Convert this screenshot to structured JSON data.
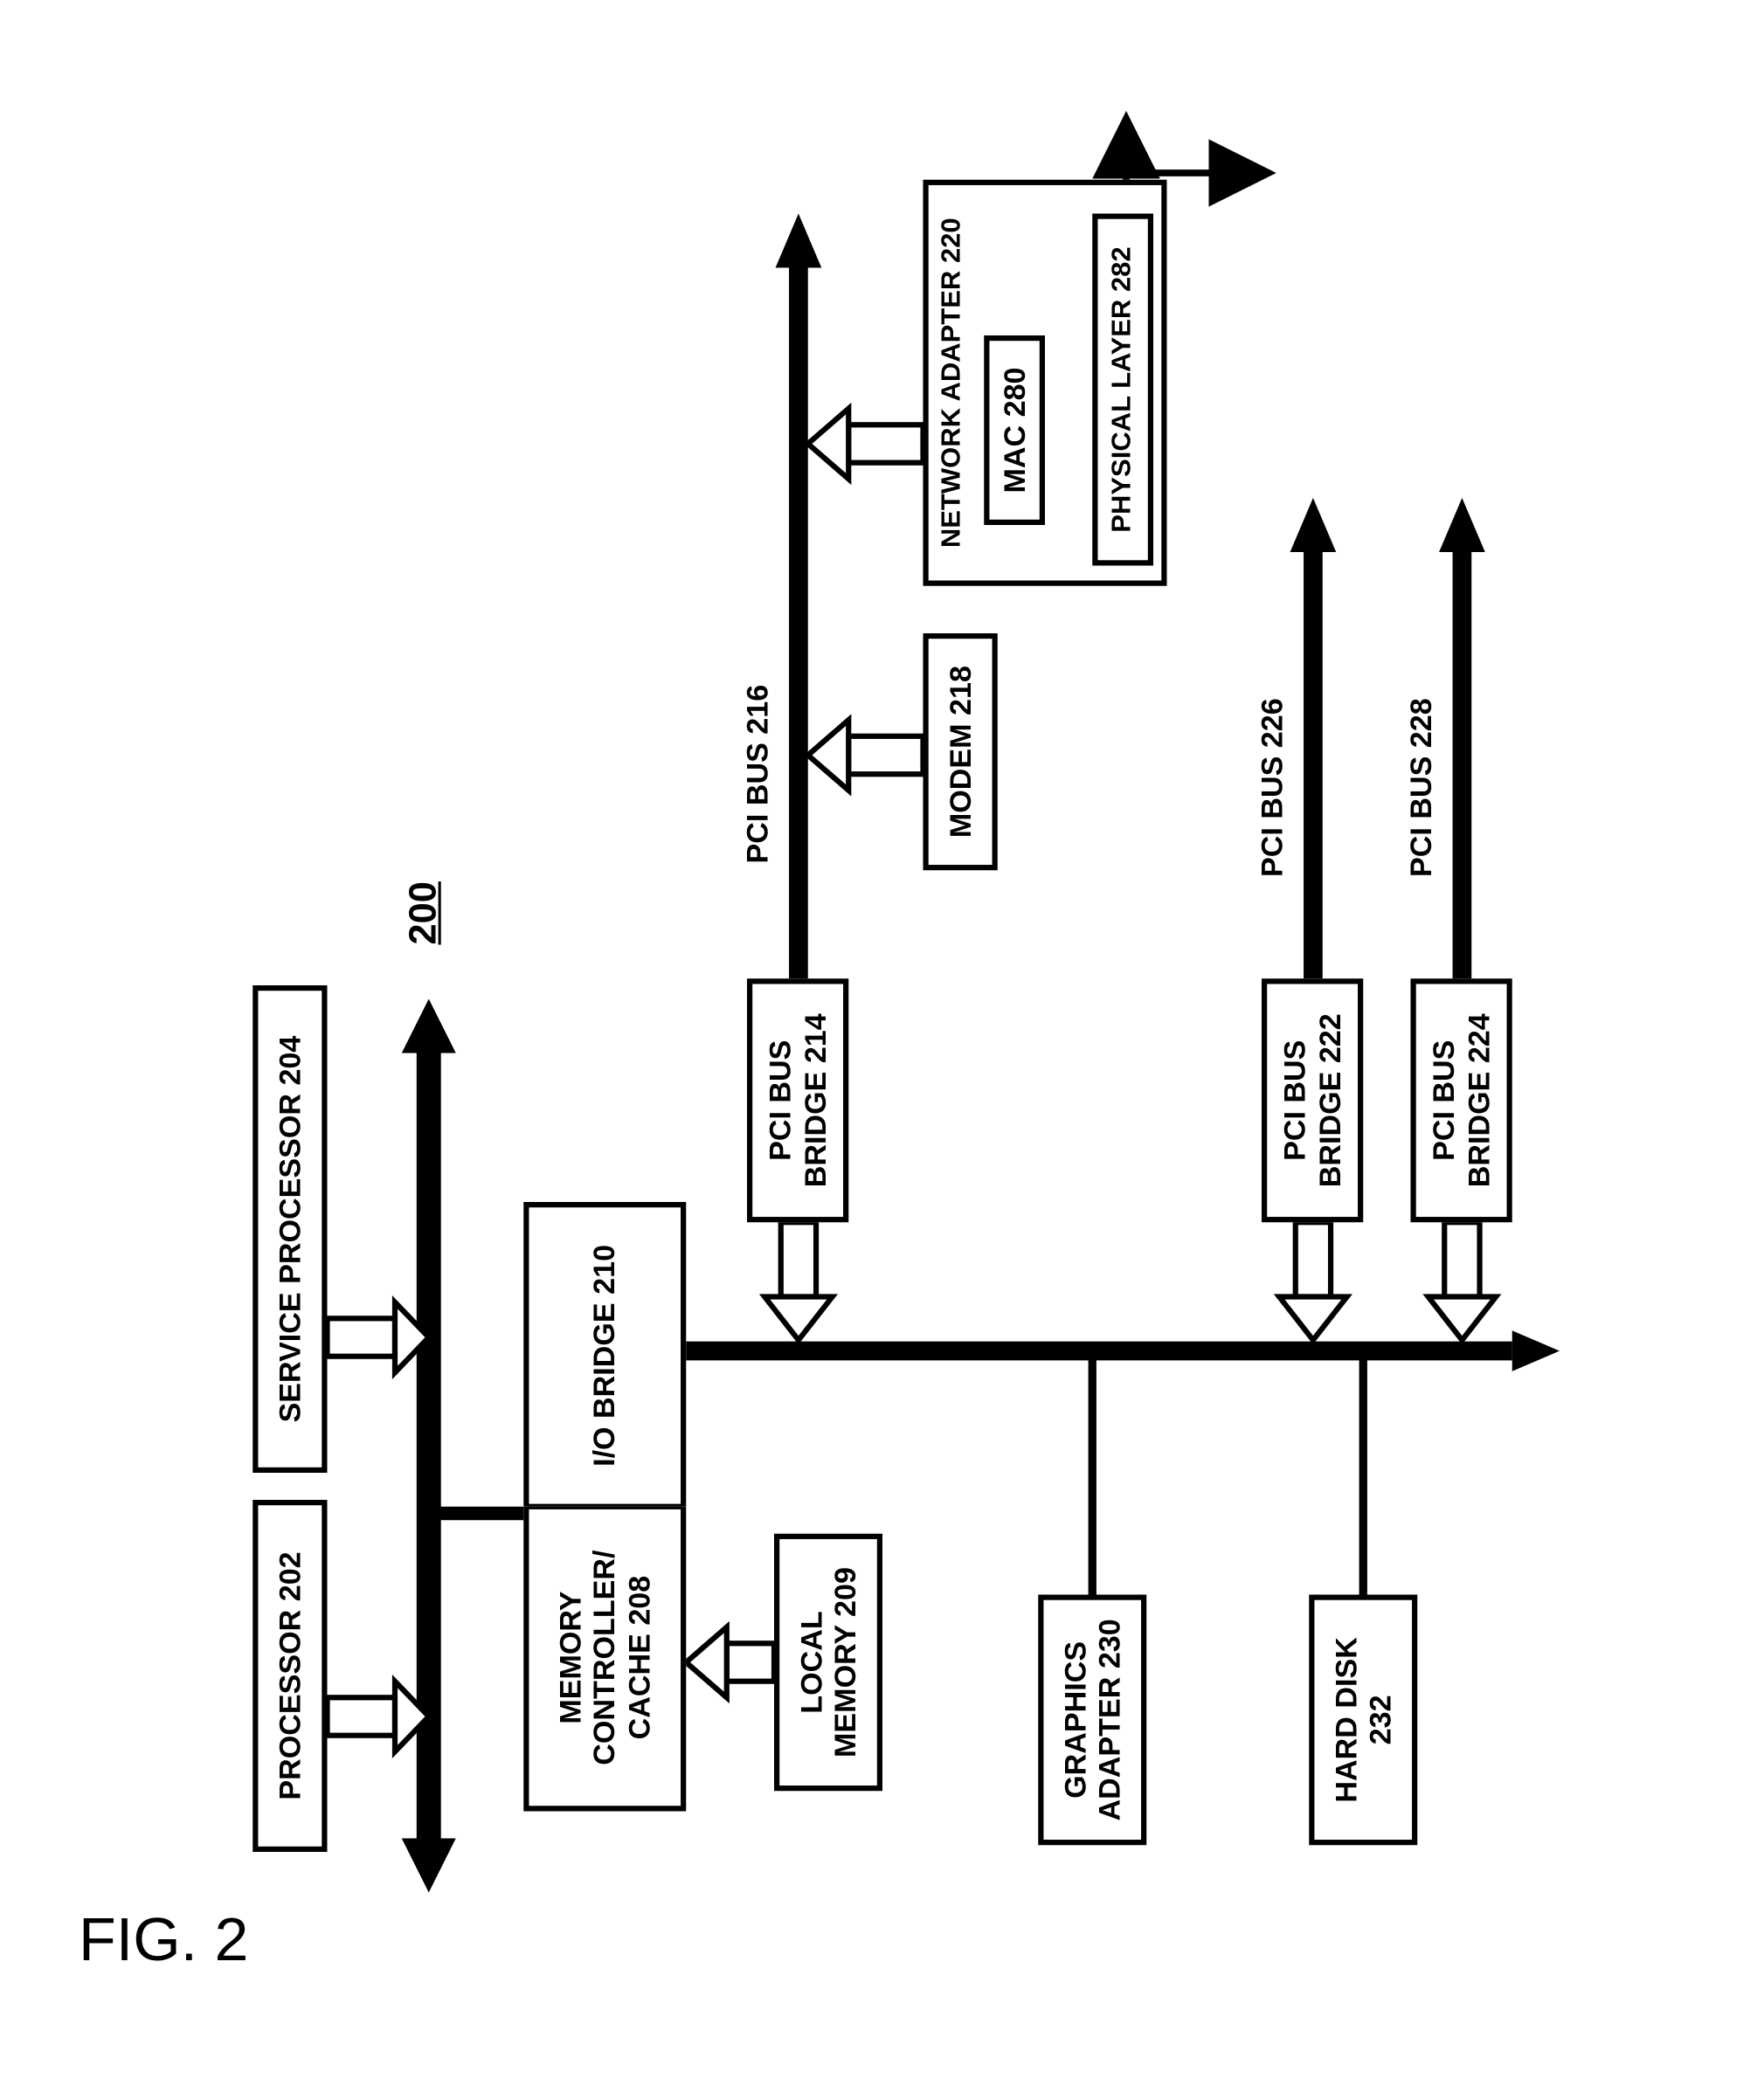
{
  "figure_label": "FIG. 2",
  "diagram_id": "200",
  "blocks": {
    "processor": "PROCESSOR 202",
    "service_processor": "SERVICE PROCESSOR 204",
    "mem_ctrl_l1": "MEMORY",
    "mem_ctrl_l2": "CONTROLLER/",
    "mem_ctrl_l3": "CACHE 208",
    "io_bridge": "I/O BRIDGE 210",
    "local_memory_l1": "LOCAL",
    "local_memory_l2": "MEMORY 209",
    "graphics_l1": "GRAPHICS",
    "graphics_l2": "ADAPTER 230",
    "hard_disk_l1": "HARD DISK",
    "hard_disk_l2": "232",
    "pci_bridge_214_l1": "PCI BUS",
    "pci_bridge_214_l2": "BRIDGE 214",
    "pci_bridge_222_l1": "PCI BUS",
    "pci_bridge_222_l2": "BRIDGE 222",
    "pci_bridge_224_l1": "PCI BUS",
    "pci_bridge_224_l2": "BRIDGE 224",
    "modem": "MODEM 218",
    "network_adapter": "NETWORK ADAPTER 220",
    "mac": "MAC 280",
    "physical_layer": "PHYSICAL LAYER 282"
  },
  "bus_labels": {
    "pci_216": "PCI BUS 216",
    "pci_226": "PCI BUS 226",
    "pci_228": "PCI BUS 228"
  }
}
